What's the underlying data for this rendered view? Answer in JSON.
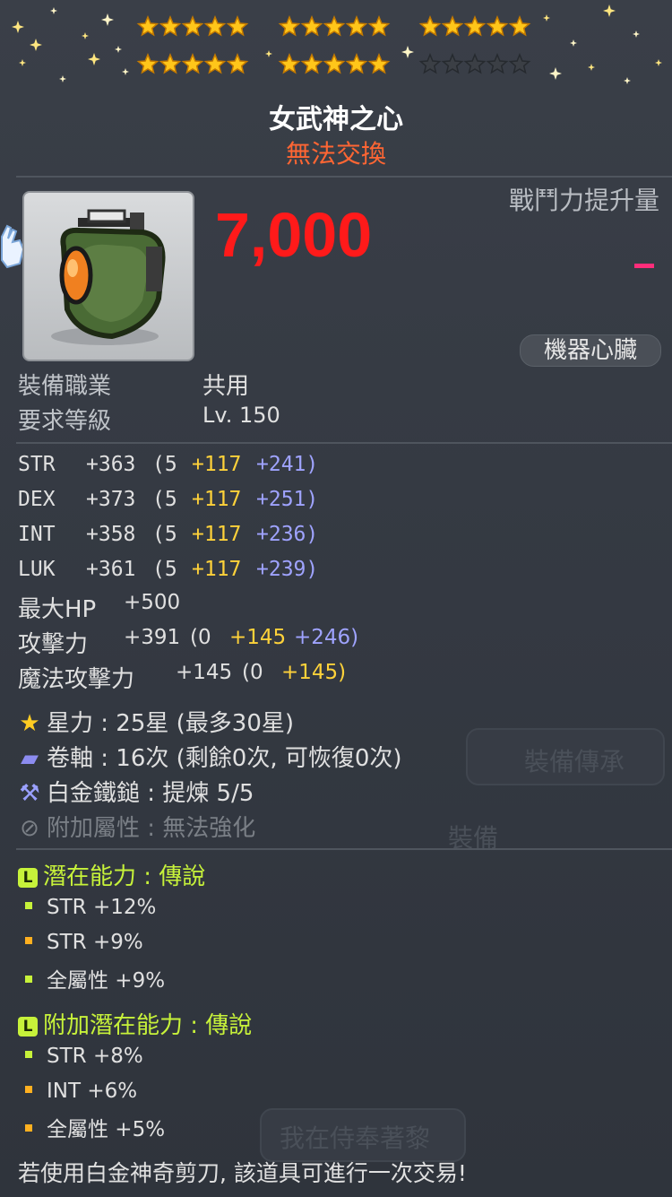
{
  "item": {
    "name": "女武神之心",
    "trade_status": "無法交換",
    "power_label": "戰鬥力提升量",
    "power_value": "7,000",
    "type_badge": "機器心臟",
    "job_label": "裝備職業",
    "job_value": "共用",
    "level_label": "要求等級",
    "level_value": "Lv. 150",
    "star_rows": [
      {
        "filled": 15
      },
      {
        "filled": 10,
        "empty": 5
      }
    ]
  },
  "stats": [
    {
      "name": "STR",
      "total": "+363",
      "base": "(5",
      "bonus": "+117",
      "star": "+241)"
    },
    {
      "name": "DEX",
      "total": "+373",
      "base": "(5",
      "bonus": "+117",
      "star": "+251)"
    },
    {
      "name": "INT",
      "total": "+358",
      "base": "(5",
      "bonus": "+117",
      "star": "+236)"
    },
    {
      "name": "LUK",
      "total": "+361",
      "base": "(5",
      "bonus": "+117",
      "star": "+239)"
    }
  ],
  "hp": {
    "name": "最大HP",
    "value": "+500"
  },
  "attack": {
    "name": "攻擊力",
    "total": "+391",
    "base": "(0",
    "bonus": "+145",
    "star": "+246)"
  },
  "magic": {
    "name": "魔法攻擊力",
    "total": "+145",
    "base": "(0",
    "bonus": "+145)"
  },
  "enhance": {
    "starforce": "星力 : 25星 (最多30星)",
    "scroll": "卷軸 : 16次 (剩餘0次, 可恢復0次)",
    "hammer": "白金鐵鎚 : 提煉 5/5",
    "extra": "附加屬性 : 無法強化"
  },
  "potential": {
    "title": "潛在能力 : 傳說",
    "lines": [
      "STR +12%",
      "STR +9%",
      "全屬性 +9%"
    ]
  },
  "additional": {
    "title": "附加潛在能力 : 傳說",
    "lines": [
      "STR +8%",
      "INT +6%",
      "全屬性 +5%"
    ]
  },
  "footer": "若使用白金神奇剪刀, 該道具可進行一次交易!",
  "background": {
    "inherit_button": "裝備傳承",
    "equip_button": "裝備",
    "bottom_text": "我在侍奉著黎"
  },
  "colors": {
    "power": "#ff1a1a",
    "trade": "#ff6633",
    "bonus": "#ffd23a",
    "star_bonus": "#9fa3ff",
    "potential": "#c7f23a"
  }
}
